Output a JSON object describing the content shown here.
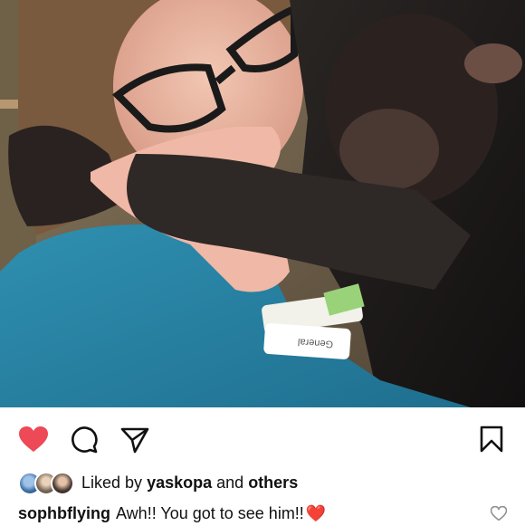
{
  "post": {
    "image_alt": "Woman with glasses being hugged by a chimpanzee holding her hand",
    "wristband_text": "General"
  },
  "actions": {
    "like_icon": "heart-filled-icon",
    "comment_icon": "comment-icon",
    "share_icon": "paper-plane-icon",
    "save_icon": "bookmark-icon",
    "like_color": "#ed4956"
  },
  "likes": {
    "prefix": "Liked by",
    "user": "yaskopa",
    "connector": "and",
    "others": "others"
  },
  "caption": {
    "username": "sophbflying",
    "text": "Awh!! You got to see him!!",
    "emoji": "❤️"
  }
}
